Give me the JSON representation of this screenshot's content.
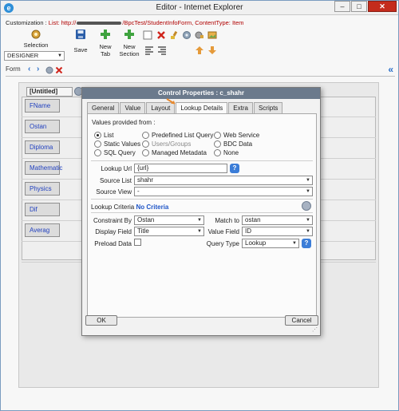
{
  "window": {
    "title": "Editor - Internet Explorer",
    "minimize": "–",
    "maximize": "□",
    "close": "✕"
  },
  "customization": {
    "label": "Customization :",
    "list_prefix": "List: http://",
    "list_suffix": "/BpcTest/StudentInfoForm, ContentType: Item"
  },
  "ribbon": {
    "selection": "Selection",
    "mode": "DESIGNER",
    "save": "Save",
    "new_tab_1": "New",
    "new_tab_2": "Tab",
    "new_section_1": "New",
    "new_section_2": "Section"
  },
  "formbar": {
    "tab": "Form"
  },
  "form": {
    "untitled": "[Untitled]",
    "fields": [
      "FName",
      "Ostan",
      "Diploma",
      "Mathematic",
      "Physics",
      "Dif",
      "Averag"
    ]
  },
  "dialog": {
    "title": "Control Properties : c_shahr",
    "tabs": [
      "General",
      "Value",
      "Layout",
      "Lookup Details",
      "Extra",
      "Scripts"
    ],
    "values_provided_from": "Values provided from :",
    "radios": {
      "list": "List",
      "predefined": "Predefined List Query",
      "webservice": "Web Service",
      "static": "Static Values",
      "users": "Users/Groups",
      "bdc": "BDC Data",
      "sql": "SQL Query",
      "metadata": "Managed Metadata",
      "none": "None"
    },
    "lookup_url_label": "Lookup Url",
    "lookup_url": "{url}",
    "source_list_label": "Source List",
    "source_list": "shahr",
    "source_view_label": "Source View",
    "source_view": "-",
    "lookup_criteria_label": "Lookup Criteria",
    "no_criteria": "No Criteria",
    "constraint_by_label": "Constraint By",
    "constraint_by": "Ostan",
    "match_to_label": "Match to",
    "match_to": "ostan",
    "display_field_label": "Display Field",
    "display_field": "Title",
    "value_field_label": "Value Field",
    "value_field": "ID",
    "preload_label": "Preload Data",
    "query_type_label": "Query Type",
    "query_type": "Lookup",
    "ok": "OK",
    "cancel": "Cancel",
    "help": "?"
  }
}
